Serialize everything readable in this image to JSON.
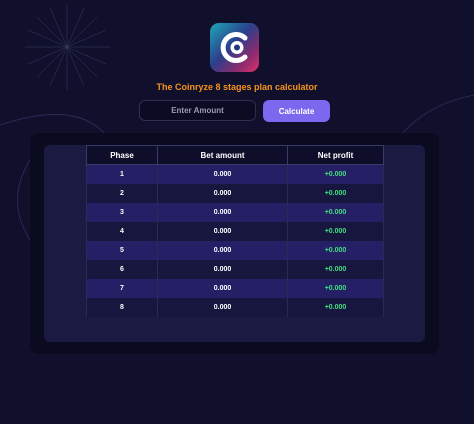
{
  "title": "The Coinryze 8 stages plan calculator",
  "amount_input": {
    "placeholder": "Enter Amount",
    "value": ""
  },
  "calculate_button": {
    "label": "Calculate"
  },
  "table": {
    "headers": [
      "Phase",
      "Bet amount",
      "Net profit"
    ],
    "rows": [
      {
        "phase": "1",
        "bet": "0.000",
        "profit": "+0.000"
      },
      {
        "phase": "2",
        "bet": "0.000",
        "profit": "+0.000"
      },
      {
        "phase": "3",
        "bet": "0.000",
        "profit": "+0.000"
      },
      {
        "phase": "4",
        "bet": "0.000",
        "profit": "+0.000"
      },
      {
        "phase": "5",
        "bet": "0.000",
        "profit": "+0.000"
      },
      {
        "phase": "6",
        "bet": "0.000",
        "profit": "+0.000"
      },
      {
        "phase": "7",
        "bet": "0.000",
        "profit": "+0.000"
      },
      {
        "phase": "8",
        "bet": "0.000",
        "profit": "+0.000"
      }
    ]
  },
  "colors": {
    "background": "#10102d",
    "title": "#f7931a",
    "button": "#7b68ee",
    "profit": "#3ee07e"
  },
  "icons": {
    "logo": "coinryze-logo-icon"
  }
}
